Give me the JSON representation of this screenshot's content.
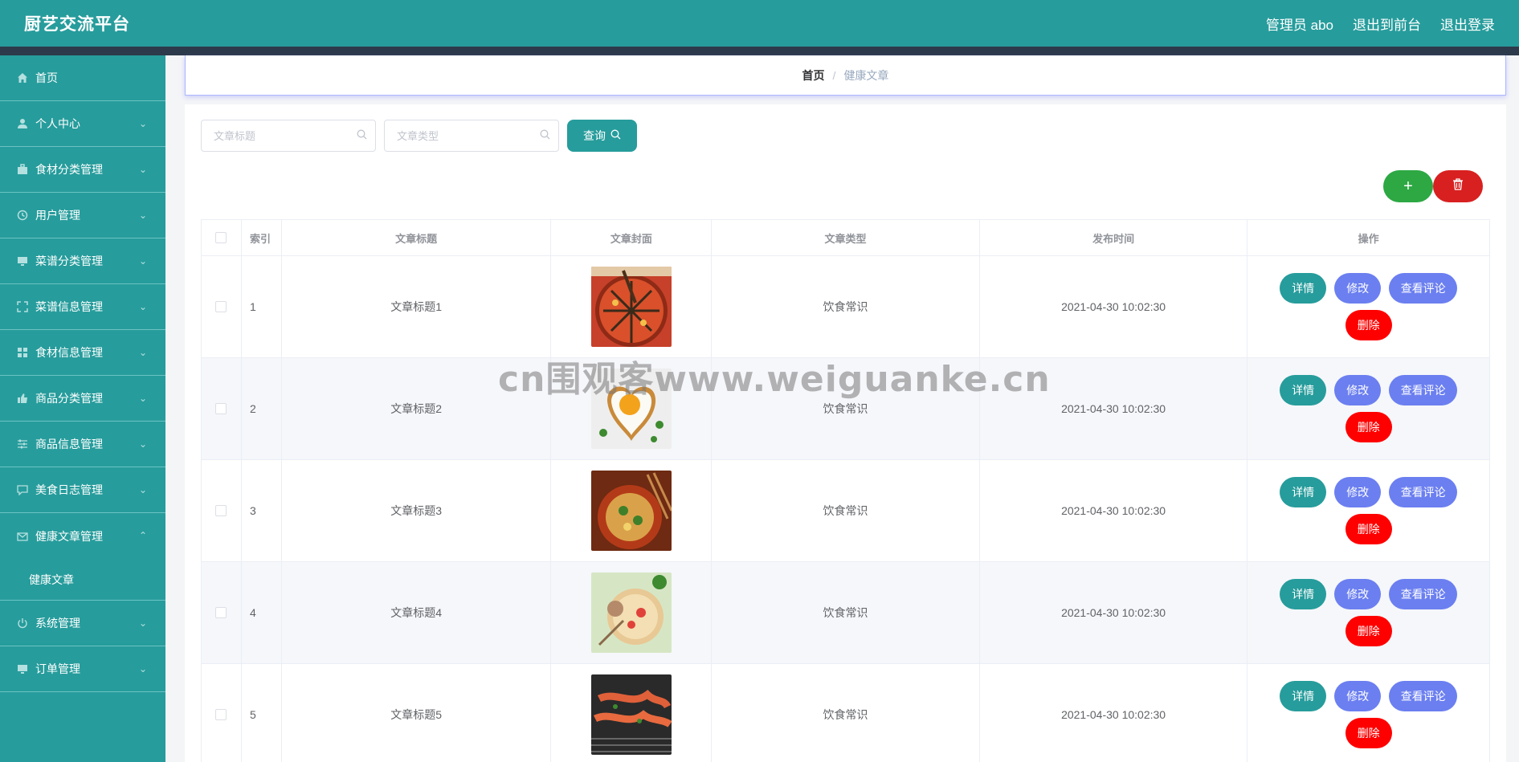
{
  "header": {
    "brand": "厨艺交流平台",
    "links": [
      "管理员 abo",
      "退出到前台",
      "退出登录"
    ]
  },
  "sidebar": {
    "items": [
      {
        "label": "首页",
        "icon": "home-icon",
        "chevron": false
      },
      {
        "label": "个人中心",
        "icon": "user-icon",
        "chevron": true
      },
      {
        "label": "食材分类管理",
        "icon": "briefcase-icon",
        "chevron": true
      },
      {
        "label": "用户管理",
        "icon": "clock-icon",
        "chevron": true
      },
      {
        "label": "菜谱分类管理",
        "icon": "monitor-icon",
        "chevron": true
      },
      {
        "label": "菜谱信息管理",
        "icon": "fullscreen-icon",
        "chevron": true
      },
      {
        "label": "食材信息管理",
        "icon": "grid-icon",
        "chevron": true
      },
      {
        "label": "商品分类管理",
        "icon": "thumb-icon",
        "chevron": true
      },
      {
        "label": "商品信息管理",
        "icon": "sliders-icon",
        "chevron": true
      },
      {
        "label": "美食日志管理",
        "icon": "chat-icon",
        "chevron": true
      },
      {
        "label": "健康文章管理",
        "icon": "mail-icon",
        "chevron": true,
        "open": true,
        "sub": "健康文章"
      },
      {
        "label": "系统管理",
        "icon": "power-icon",
        "chevron": true
      },
      {
        "label": "订单管理",
        "icon": "monitor-icon",
        "chevron": true
      }
    ]
  },
  "breadcrumb": {
    "home": "首页",
    "separator": "/",
    "current": "健康文章"
  },
  "search": {
    "title_placeholder": "文章标题",
    "type_placeholder": "文章类型",
    "query_label": "查询"
  },
  "actions": {
    "add_glyph": "+",
    "delete_glyph": "🗑"
  },
  "table": {
    "headers": [
      "索引",
      "文章标题",
      "文章封面",
      "文章类型",
      "发布时间",
      "操作"
    ],
    "rows": [
      {
        "index": "1",
        "title": "文章标题1",
        "type": "饮食常识",
        "time": "2021-04-30 10:02:30",
        "cover": "hotpot"
      },
      {
        "index": "2",
        "title": "文章标题2",
        "type": "饮食常识",
        "time": "2021-04-30 10:02:30",
        "cover": "egg"
      },
      {
        "index": "3",
        "title": "文章标题3",
        "type": "饮食常识",
        "time": "2021-04-30 10:02:30",
        "cover": "noodles"
      },
      {
        "index": "4",
        "title": "文章标题4",
        "type": "饮食常识",
        "time": "2021-04-30 10:02:30",
        "cover": "platter"
      },
      {
        "index": "5",
        "title": "文章标题5",
        "type": "饮食常识",
        "time": "2021-04-30 10:02:30",
        "cover": "grill"
      }
    ],
    "ops": {
      "detail": "详情",
      "edit": "修改",
      "comment": "查看评论",
      "delete": "删除"
    }
  },
  "watermark": "cn围观客www.weiguanke.cn"
}
